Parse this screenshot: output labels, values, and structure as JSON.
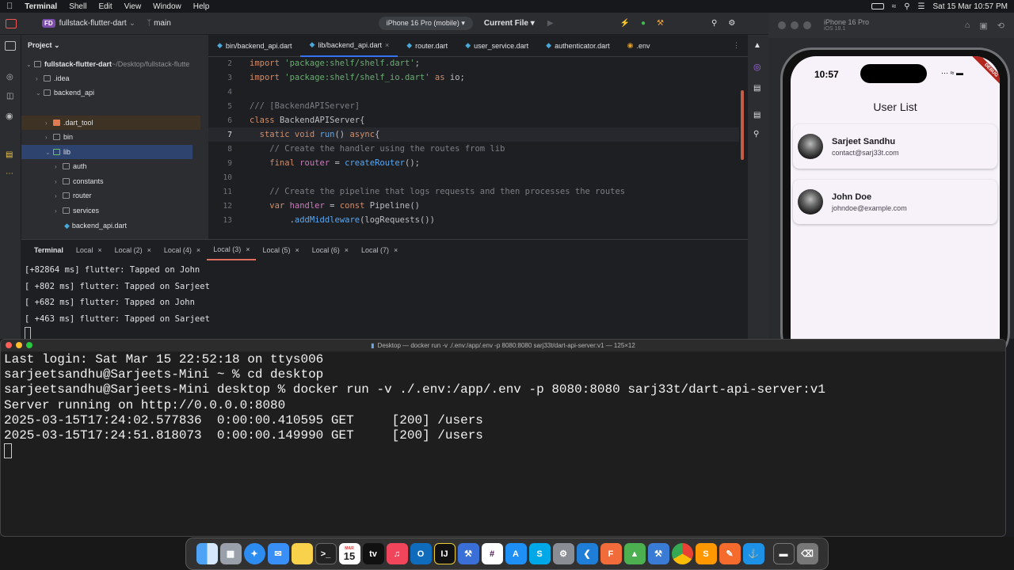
{
  "menubar": {
    "apple": "",
    "items": [
      "Terminal",
      "Shell",
      "Edit",
      "View",
      "Window",
      "Help"
    ],
    "datetime": "Sat 15 Mar  10:57 PM"
  },
  "ide": {
    "project_badge": "FD",
    "project_name": "fullstack-flutter-dart",
    "branch": "main",
    "device": "iPhone 16 Pro (mobile)",
    "run_config": "Current File",
    "project_label": "Project",
    "tree": [
      {
        "label": "fullstack-flutter-dart",
        "suffix": " ~/Desktop/fullstack-flutte"
      },
      {
        "label": ".idea",
        "suffix": ""
      },
      {
        "label": "backend_api",
        "suffix": ""
      },
      {
        "label": ".dart_tool",
        "suffix": ""
      },
      {
        "label": "bin",
        "suffix": ""
      },
      {
        "label": "lib",
        "suffix": ""
      },
      {
        "label": "auth",
        "suffix": ""
      },
      {
        "label": "constants",
        "suffix": ""
      },
      {
        "label": "router",
        "suffix": ""
      },
      {
        "label": "services",
        "suffix": ""
      },
      {
        "label": "backend_api.dart",
        "suffix": ""
      }
    ],
    "tabs": [
      "bin/backend_api.dart",
      "lib/backend_api.dart",
      "router.dart",
      "user_service.dart",
      "authenticator.dart",
      ".env"
    ],
    "code": [
      {
        "ln": "2",
        "text": ""
      },
      {
        "ln": "3",
        "text": ""
      },
      {
        "ln": "4",
        "text": ""
      },
      {
        "ln": "5",
        "text": ""
      },
      {
        "ln": "6",
        "text": ""
      },
      {
        "ln": "7",
        "text": ""
      },
      {
        "ln": "8",
        "text": ""
      },
      {
        "ln": "9",
        "text": ""
      },
      {
        "ln": "10",
        "text": ""
      },
      {
        "ln": "11",
        "text": ""
      },
      {
        "ln": "12",
        "text": ""
      },
      {
        "ln": "13",
        "text": ""
      }
    ],
    "terminal_tabs": [
      "Terminal",
      "Local",
      "Local (2)",
      "Local (4)",
      "Local (3)",
      "Local (5)",
      "Local (6)",
      "Local (7)"
    ],
    "terminal_lines": [
      "[+82864 ms] flutter: Tapped on John",
      "[ +802 ms] flutter: Tapped on Sarjeet",
      "[ +682 ms] flutter: Tapped on John",
      "[ +463 ms] flutter: Tapped on Sarjeet"
    ]
  },
  "simulator": {
    "device": "iPhone 16 Pro",
    "os": "iOS 18.1",
    "time": "10:57",
    "debug": "DEBUG",
    "app_title": "User List",
    "users": [
      {
        "name": "Sarjeet Sandhu",
        "email": "contact@sarj33t.com"
      },
      {
        "name": "John Doe",
        "email": "johndoe@example.com"
      }
    ]
  },
  "mac_terminal": {
    "title": "Desktop — docker run -v ./.env:/app/.env -p 8080:8080 sarj33t/dart-api-server:v1 — 125×12",
    "lines": [
      "Last login: Sat Mar 15 22:52:18 on ttys006",
      "sarjeetsandhu@Sarjeets-Mini ~ % cd desktop",
      "sarjeetsandhu@Sarjeets-Mini desktop % docker run -v ./.env:/app/.env -p 8080:8080 sarj33t/dart-api-server:v1",
      "Server running on http://0.0.0.0:8080",
      "2025-03-15T17:24:02.577836  0:00:00.410595 GET     [200] /users",
      "2025-03-15T17:24:51.818073  0:00:00.149990 GET     [200] /users"
    ]
  },
  "dock": {
    "calendar_month": "MAR",
    "calendar_day": "15",
    "apps": [
      "finder",
      "launchpad",
      "safari",
      "mail",
      "notes",
      "terminal",
      "calendar",
      "tv",
      "music",
      "outlook",
      "intellij",
      "xcode-instruments",
      "slack",
      "app-store",
      "skype",
      "system-settings",
      "vscode",
      "figma",
      "android-studio",
      "xcode",
      "chrome",
      "sublime",
      "sketch",
      "docker",
      "screen",
      "trash"
    ]
  }
}
